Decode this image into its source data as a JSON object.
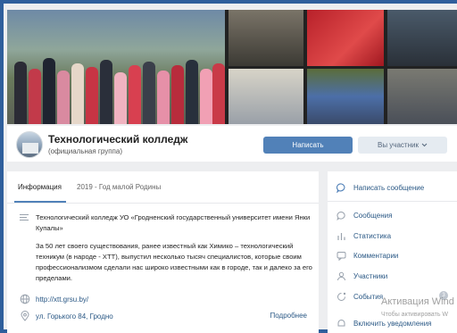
{
  "group": {
    "title": "Технологический колледж",
    "subtitle": "(официальная группа)"
  },
  "buttons": {
    "write": "Написать",
    "member": "Вы участник",
    "member_icon": "chevron-down-icon"
  },
  "tabs": [
    {
      "label": "Информация",
      "active": true
    },
    {
      "label": "2019 - Год малой Родины",
      "active": false
    }
  ],
  "info": {
    "description_1": "Технологический колледж УО «Гродненский государственный университет имени Янки Купалы»",
    "description_2": "За 50 лет своего существования, ранее известный как Химико – технологический техникум (в народе - ХТТ), выпустил несколько тысяч специалистов, которые своим профессионализмом сделали нас широко известными как в городе, так и далеко за его пределами.",
    "website": "http://xtt.grsu.by/",
    "address": "ул. Горького 84, Гродно",
    "more": "Подробнее"
  },
  "menu": {
    "write_message": "Написать сообщение",
    "items": [
      {
        "label": "Сообщения",
        "icon": "chat-bubble-icon"
      },
      {
        "label": "Статистика",
        "icon": "bar-chart-icon"
      },
      {
        "label": "Комментарии",
        "icon": "comments-icon"
      },
      {
        "label": "Участники",
        "icon": "person-icon"
      },
      {
        "label": "События",
        "icon": "events-icon"
      },
      {
        "label": "Включить уведомления",
        "icon": "bell-icon"
      }
    ]
  },
  "watermark": {
    "title": "Активация Wind",
    "subtitle": "Чтобы активировать W"
  },
  "colors": {
    "accent": "#5181b8",
    "link": "#2a5885",
    "background": "#edeef0"
  }
}
